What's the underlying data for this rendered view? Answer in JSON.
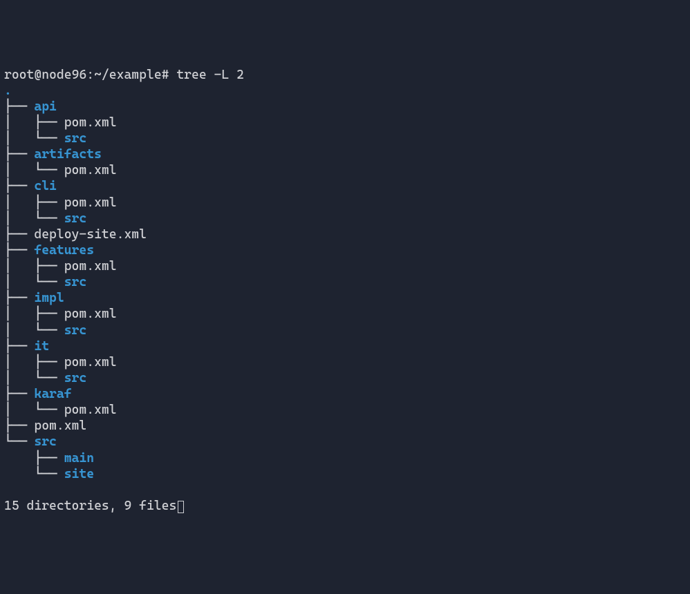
{
  "prompt": {
    "user": "root",
    "host": "node96",
    "path": "~/example",
    "symbol": "#",
    "command": "tree -L 2"
  },
  "rootDot": ".",
  "tree": [
    {
      "prefix": "├── ",
      "name": "api",
      "type": "dir"
    },
    {
      "prefix": "│   ├── ",
      "name": "pom.xml",
      "type": "file"
    },
    {
      "prefix": "│   └── ",
      "name": "src",
      "type": "dir"
    },
    {
      "prefix": "├── ",
      "name": "artifacts",
      "type": "dir"
    },
    {
      "prefix": "│   └── ",
      "name": "pom.xml",
      "type": "file"
    },
    {
      "prefix": "├── ",
      "name": "cli",
      "type": "dir"
    },
    {
      "prefix": "│   ├── ",
      "name": "pom.xml",
      "type": "file"
    },
    {
      "prefix": "│   └── ",
      "name": "src",
      "type": "dir"
    },
    {
      "prefix": "├── ",
      "name": "deploy-site.xml",
      "type": "file"
    },
    {
      "prefix": "├── ",
      "name": "features",
      "type": "dir"
    },
    {
      "prefix": "│   ├── ",
      "name": "pom.xml",
      "type": "file"
    },
    {
      "prefix": "│   └── ",
      "name": "src",
      "type": "dir"
    },
    {
      "prefix": "├── ",
      "name": "impl",
      "type": "dir"
    },
    {
      "prefix": "│   ├── ",
      "name": "pom.xml",
      "type": "file"
    },
    {
      "prefix": "│   └── ",
      "name": "src",
      "type": "dir"
    },
    {
      "prefix": "├── ",
      "name": "it",
      "type": "dir"
    },
    {
      "prefix": "│   ├── ",
      "name": "pom.xml",
      "type": "file"
    },
    {
      "prefix": "│   └── ",
      "name": "src",
      "type": "dir"
    },
    {
      "prefix": "├── ",
      "name": "karaf",
      "type": "dir"
    },
    {
      "prefix": "│   └── ",
      "name": "pom.xml",
      "type": "file"
    },
    {
      "prefix": "├── ",
      "name": "pom.xml",
      "type": "file"
    },
    {
      "prefix": "└── ",
      "name": "src",
      "type": "dir"
    },
    {
      "prefix": "    ├── ",
      "name": "main",
      "type": "dir"
    },
    {
      "prefix": "    └── ",
      "name": "site",
      "type": "dir"
    }
  ],
  "summary": "15 directories, 9 files"
}
